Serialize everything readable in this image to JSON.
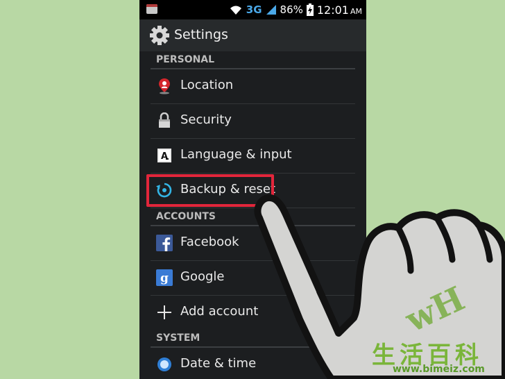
{
  "status_bar": {
    "network": "3G",
    "battery": "86%",
    "time": "12:01",
    "ampm": "AM"
  },
  "header": {
    "title": "Settings"
  },
  "sections": [
    {
      "title": "PERSONAL",
      "items": [
        {
          "label": "Location",
          "icon": "location-pin-icon"
        },
        {
          "label": "Security",
          "icon": "lock-icon"
        },
        {
          "label": "Language & input",
          "icon": "keyboard-a-icon"
        },
        {
          "label": "Backup & reset",
          "icon": "backup-restore-icon"
        }
      ]
    },
    {
      "title": "ACCOUNTS",
      "items": [
        {
          "label": "Facebook",
          "icon": "facebook-icon"
        },
        {
          "label": "Google",
          "icon": "google-icon"
        },
        {
          "label": "Add account",
          "icon": "plus-icon"
        }
      ]
    },
    {
      "title": "SYSTEM",
      "items": [
        {
          "label": "Date & time",
          "icon": "clock-globe-icon"
        }
      ]
    }
  ],
  "watermark": {
    "hanzi": "生活百科",
    "url": "www.bimeiz.com",
    "mark": "wH"
  },
  "colors": {
    "highlight": "#e2263b",
    "accent": "#33b5e5",
    "background": "#b8d8a4"
  }
}
